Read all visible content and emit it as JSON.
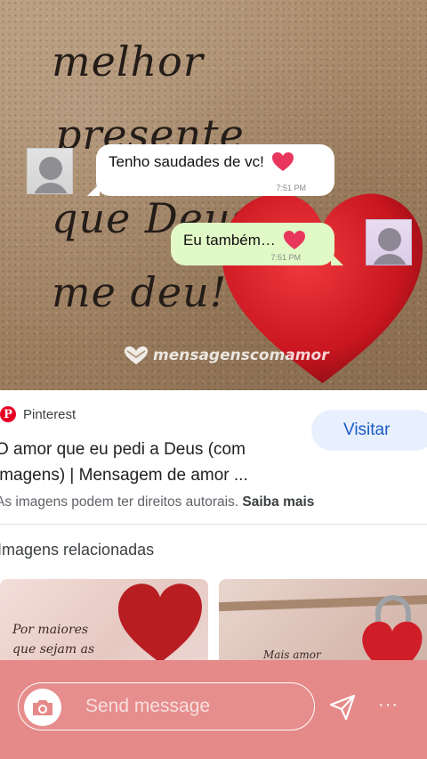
{
  "hero": {
    "script_lines": [
      "melhor",
      "presente",
      "que Deus",
      "me deu!"
    ],
    "watermark": "mensagenscomamor"
  },
  "chat": {
    "incoming": {
      "text": "Tenho saudades de vc!",
      "time": "7:51 PM"
    },
    "outgoing": {
      "text": "Eu também…",
      "time": "7:51 PM"
    }
  },
  "result": {
    "source": "Pinterest",
    "visit_label": "Visitar",
    "title": "O amor que eu pedi a Deus (com imagens) | Mensagem de amor ...",
    "rights_text": "As imagens podem ter direitos autorais.",
    "learn_more": "Saiba mais",
    "related_title": "Imagens relacionadas",
    "thumb1_text": [
      "Por maiores",
      "que sejam as"
    ],
    "thumb2_text": "Mais amor"
  },
  "composer": {
    "placeholder": "Send message",
    "more": "···"
  },
  "colors": {
    "composer_bg": "#e58a89",
    "visit_bg": "#e8f0fe",
    "visit_text": "#1a5bc4",
    "outgoing_bubble": "#e1f9c6",
    "heart": "#d6202a"
  }
}
